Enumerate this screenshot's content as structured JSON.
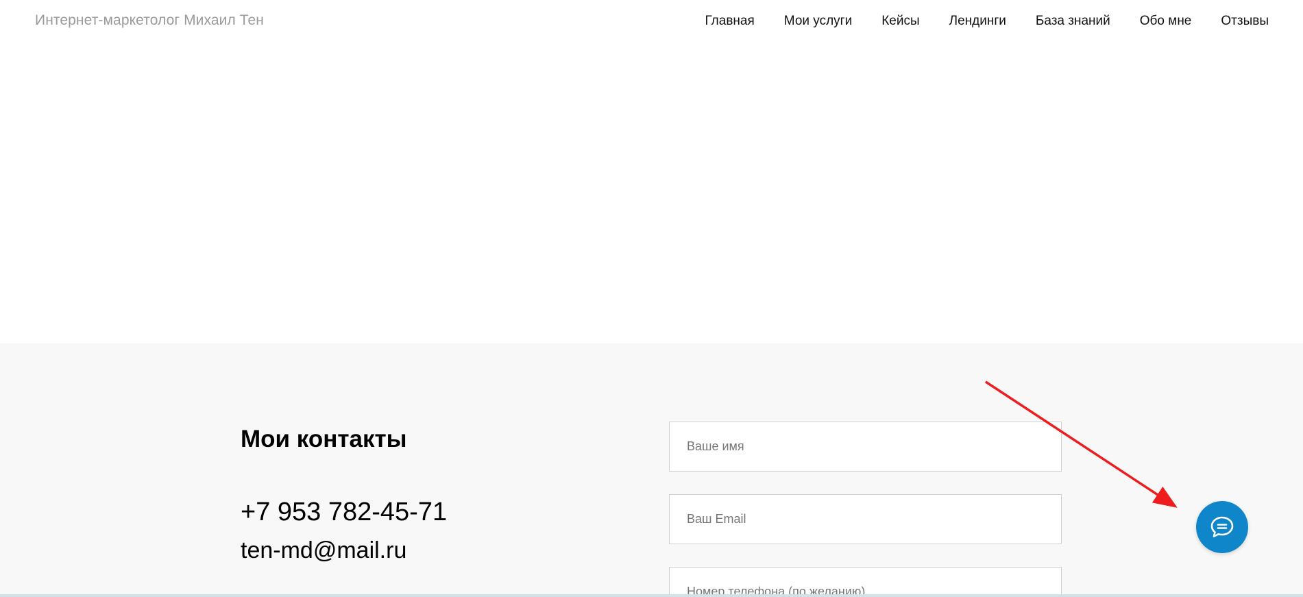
{
  "header": {
    "site_title": "Интернет-маркетолог Михаил Тен",
    "nav": [
      {
        "label": "Главная"
      },
      {
        "label": "Мои услуги"
      },
      {
        "label": "Кейсы"
      },
      {
        "label": "Лендинги"
      },
      {
        "label": "База знаний"
      },
      {
        "label": "Обо мне"
      },
      {
        "label": "Отзывы"
      }
    ]
  },
  "contacts": {
    "title": "Мои контакты",
    "phone": "+7 953 782-45-71",
    "email": "ten-md@mail.ru"
  },
  "form": {
    "name_placeholder": "Ваше имя",
    "email_placeholder": "Ваш Email",
    "phone_placeholder": "Номер телефона (по желанию)"
  },
  "chat_widget": {
    "icon": "chat-bubble-icon"
  },
  "annotation": {
    "arrow_color": "#ee1c1c"
  },
  "colors": {
    "contacts_background": "#f8f8f8",
    "chat_button": "#0f86c9",
    "site_title": "#9a9a9a"
  }
}
